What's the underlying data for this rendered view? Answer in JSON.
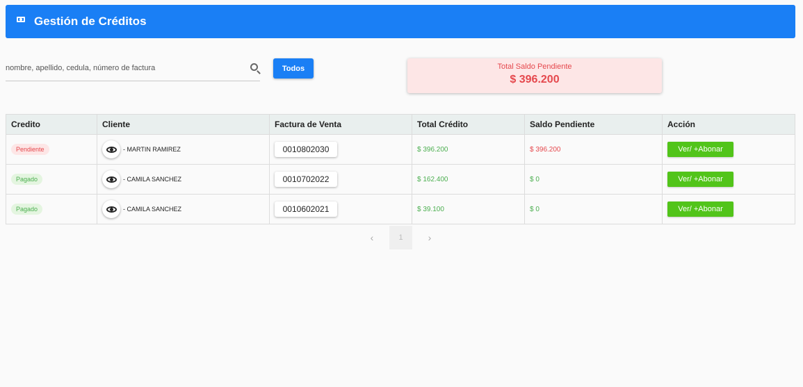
{
  "header": {
    "title": "Gestión de Créditos",
    "icon": "money-icon"
  },
  "search": {
    "placeholder": "nombre, apellido, cedula, número de factura",
    "value": ""
  },
  "filter_button": "Todos",
  "total_card": {
    "label": "Total Saldo Pendiente",
    "value": "$ 396.200"
  },
  "table": {
    "columns": [
      "Credito",
      "Cliente",
      "Factura de Venta",
      "Total Crédito",
      "Saldo Pendiente",
      "Acción"
    ],
    "rows": [
      {
        "status": "Pendiente",
        "client": "- MARTIN RAMIREZ",
        "invoice": "0010802030",
        "total": "$ 396.200",
        "balance": "$ 396.200",
        "action": "Ver/ +Abonar"
      },
      {
        "status": "Pagado",
        "client": "- CAMILA SANCHEZ",
        "invoice": "0010702022",
        "total": "$ 162.400",
        "balance": "$ 0",
        "action": "Ver/ +Abonar"
      },
      {
        "status": "Pagado",
        "client": "- CAMILA SANCHEZ",
        "invoice": "0010602021",
        "total": "$ 39.100",
        "balance": "$ 0",
        "action": "Ver/ +Abonar"
      }
    ]
  },
  "pagination": {
    "current_page": "1"
  },
  "colors": {
    "primary": "#1a7ff5",
    "danger": "#e5484d",
    "success": "#52c41a"
  }
}
